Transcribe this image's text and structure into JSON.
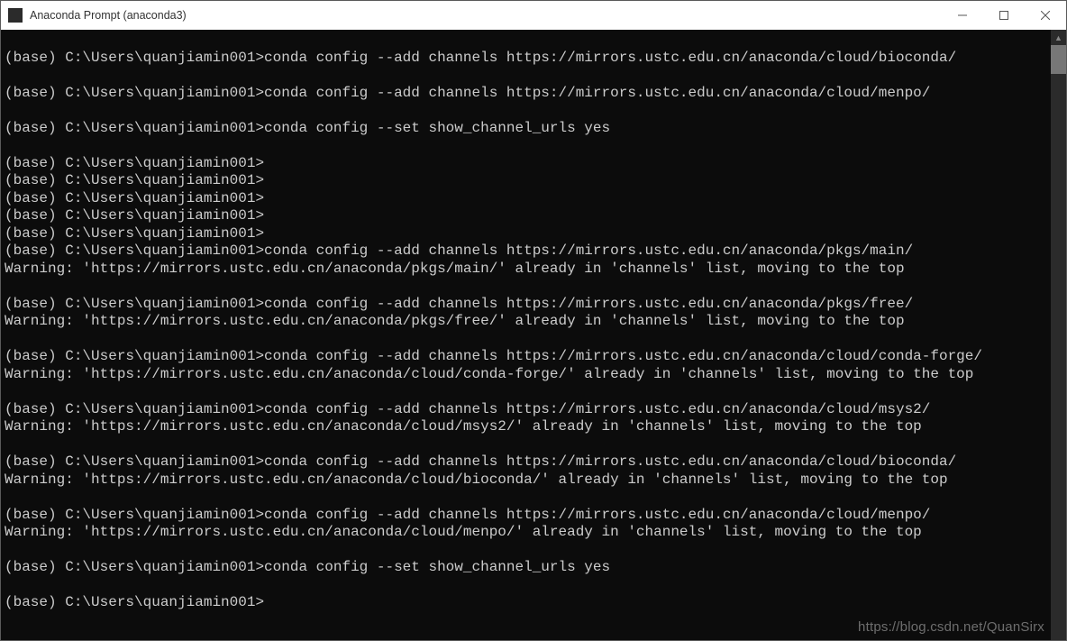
{
  "window": {
    "title": "Anaconda Prompt (anaconda3)"
  },
  "prompt_prefix": "(base) C:\\Users\\quanjiamin001>",
  "terminal_lines": [
    "",
    "(base) C:\\Users\\quanjiamin001>conda config --add channels https://mirrors.ustc.edu.cn/anaconda/cloud/bioconda/",
    "",
    "(base) C:\\Users\\quanjiamin001>conda config --add channels https://mirrors.ustc.edu.cn/anaconda/cloud/menpo/",
    "",
    "(base) C:\\Users\\quanjiamin001>conda config --set show_channel_urls yes",
    "",
    "(base) C:\\Users\\quanjiamin001>",
    "(base) C:\\Users\\quanjiamin001>",
    "(base) C:\\Users\\quanjiamin001>",
    "(base) C:\\Users\\quanjiamin001>",
    "(base) C:\\Users\\quanjiamin001>",
    "(base) C:\\Users\\quanjiamin001>conda config --add channels https://mirrors.ustc.edu.cn/anaconda/pkgs/main/",
    "Warning: 'https://mirrors.ustc.edu.cn/anaconda/pkgs/main/' already in 'channels' list, moving to the top",
    "",
    "(base) C:\\Users\\quanjiamin001>conda config --add channels https://mirrors.ustc.edu.cn/anaconda/pkgs/free/",
    "Warning: 'https://mirrors.ustc.edu.cn/anaconda/pkgs/free/' already in 'channels' list, moving to the top",
    "",
    "(base) C:\\Users\\quanjiamin001>conda config --add channels https://mirrors.ustc.edu.cn/anaconda/cloud/conda-forge/",
    "Warning: 'https://mirrors.ustc.edu.cn/anaconda/cloud/conda-forge/' already in 'channels' list, moving to the top",
    "",
    "(base) C:\\Users\\quanjiamin001>conda config --add channels https://mirrors.ustc.edu.cn/anaconda/cloud/msys2/",
    "Warning: 'https://mirrors.ustc.edu.cn/anaconda/cloud/msys2/' already in 'channels' list, moving to the top",
    "",
    "(base) C:\\Users\\quanjiamin001>conda config --add channels https://mirrors.ustc.edu.cn/anaconda/cloud/bioconda/",
    "Warning: 'https://mirrors.ustc.edu.cn/anaconda/cloud/bioconda/' already in 'channels' list, moving to the top",
    "",
    "(base) C:\\Users\\quanjiamin001>conda config --add channels https://mirrors.ustc.edu.cn/anaconda/cloud/menpo/",
    "Warning: 'https://mirrors.ustc.edu.cn/anaconda/cloud/menpo/' already in 'channels' list, moving to the top",
    "",
    "(base) C:\\Users\\quanjiamin001>conda config --set show_channel_urls yes",
    "",
    "(base) C:\\Users\\quanjiamin001>"
  ],
  "watermark": "https://blog.csdn.net/QuanSirx"
}
